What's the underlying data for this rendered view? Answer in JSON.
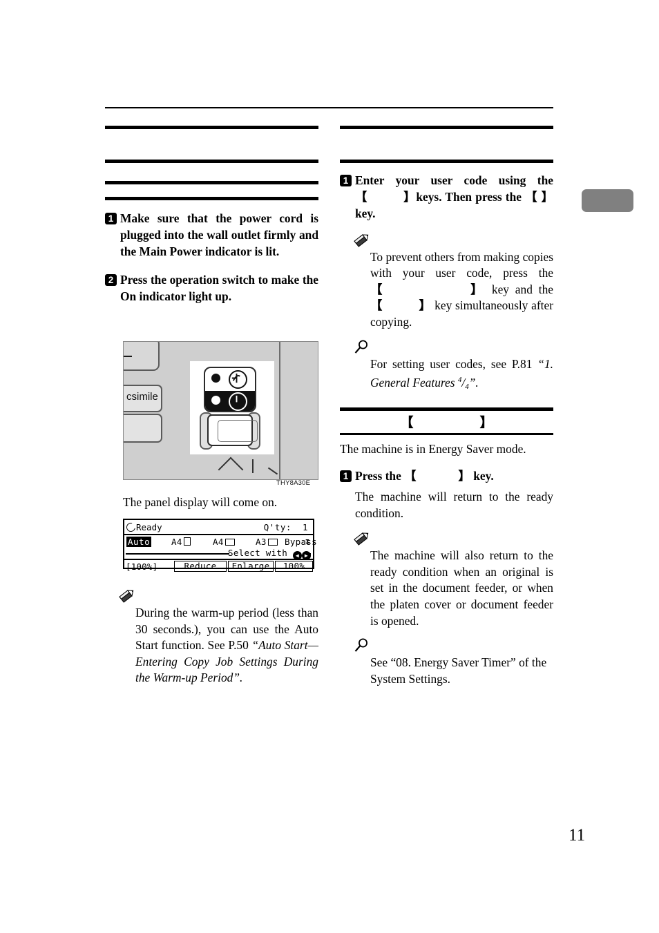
{
  "page": {
    "number": "11",
    "chapter_tab_color": "#808080"
  },
  "left_column": {
    "heading_1": "",
    "heading_2": "",
    "heading_3": "",
    "steps": [
      {
        "badge": "1",
        "text": "Make sure that the power cord is plugged into the wall outlet firmly and the Main Power indicator is lit."
      },
      {
        "badge": "2",
        "text": "Press the operation switch to make the On indicator light up."
      }
    ],
    "figure_caption": "THY8A30E",
    "after_figure_text": "The panel display will come on.",
    "note": {
      "icon": "pencil-icon",
      "text_plain": "During the warm-up period (less than 30 seconds.), you can use the Auto Start function. See P.50 ",
      "text_italic": "“Auto Start—Entering Copy Job Settings During the Warm-up Period”."
    }
  },
  "right_column": {
    "heading_1": "",
    "heading_2": "",
    "steps": [
      {
        "badge": "1",
        "text_before": "Enter your user code using the",
        "key_1": "【          】",
        "text_mid": "keys. Then press the",
        "key_2": "【 】",
        "text_after": "key."
      }
    ],
    "note_pencil": {
      "icon": "pencil-icon",
      "part1": "To prevent others from making copies with your user code, press the",
      "key_1": "【              】",
      "part2": "key and the",
      "key_2": "【           】",
      "part3": "key simultaneously after copying."
    },
    "note_ref": {
      "icon": "magnifier-icon",
      "text_plain": "For setting user codes, see P.81 ",
      "text_italic": "“1. General Features ",
      "fraction_num": "4",
      "fraction_den": "4",
      "text_italic_end": "”."
    },
    "energy_heading": {
      "key_bracket_open": "【",
      "key_bracket_close": "】"
    },
    "energy_intro": "The machine is in Energy Saver mode.",
    "energy_step": {
      "badge": "1",
      "text_before": "Press the",
      "key": "【              】",
      "text_after": "key."
    },
    "energy_result": "The machine will return to the ready condition.",
    "note_energy": {
      "icon": "pencil-icon",
      "text": "The machine will also return to the ready condition when an original is set in the document feeder, or when the platen cover or document feeder is opened."
    },
    "note_energy_ref": {
      "icon": "magnifier-icon",
      "text": "See “08. Energy Saver Timer” of the System Settings."
    }
  },
  "lcd_display": {
    "status": "Ready",
    "quantity_label": "Q'ty:",
    "quantity_value": "1",
    "paper_auto": "Auto",
    "paper_1": "A4",
    "paper_2": "A4",
    "paper_3": "A3",
    "paper_bypass": "Bypass",
    "select_with": "Select with",
    "zoom_current": "[100%]",
    "button_reduce": "Reduce",
    "button_enlarge": "Enlarge",
    "button_100": "100%"
  },
  "control_panel_figure": {
    "label_facsimile": "csimile",
    "enter_icon": "enter-arrow-icon",
    "main_power_icon": "power-wave-icon",
    "operation_icon": "power-on-icon"
  }
}
